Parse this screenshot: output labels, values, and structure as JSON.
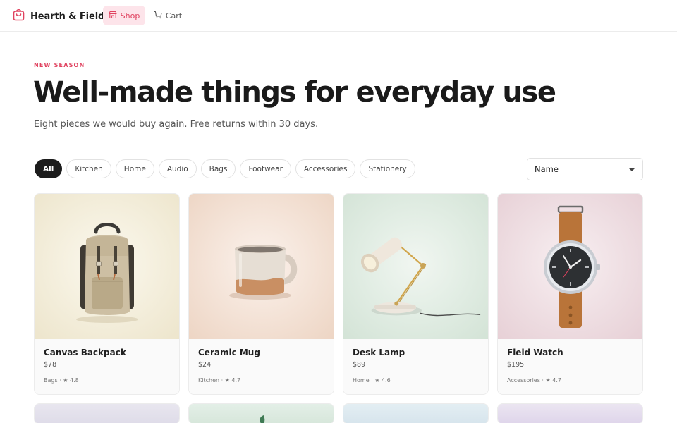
{
  "brand": {
    "name": "Hearth & Field",
    "icon": "shopping-bag-icon"
  },
  "nav": [
    {
      "label": "Shop",
      "icon": "storefront-icon",
      "active": true
    },
    {
      "label": "Cart",
      "icon": "cart-icon",
      "active": false
    }
  ],
  "hero": {
    "eyebrow": "NEW SEASON",
    "title": "Well-made things for everyday use",
    "subtitle": "Eight pieces we would buy again. Free returns within 30 days."
  },
  "filters": [
    "All",
    "Kitchen",
    "Home",
    "Audio",
    "Bags",
    "Footwear",
    "Accessories",
    "Stationery"
  ],
  "active_filter": "All",
  "sort": {
    "selected": "Name"
  },
  "products": [
    {
      "name": "Canvas Backpack",
      "price": "$78",
      "meta": "Bags · ★ 4.8"
    },
    {
      "name": "Ceramic Mug",
      "price": "$24",
      "meta": "Kitchen · ★ 4.7"
    },
    {
      "name": "Desk Lamp",
      "price": "$89",
      "meta": "Home · ★ 4.6"
    },
    {
      "name": "Field Watch",
      "price": "$195",
      "meta": "Accessories · ★ 4.7"
    }
  ],
  "colors": {
    "accent": "#e0425f",
    "accent_bg": "#fde4ea",
    "chip_active": "#1c1c1c"
  }
}
